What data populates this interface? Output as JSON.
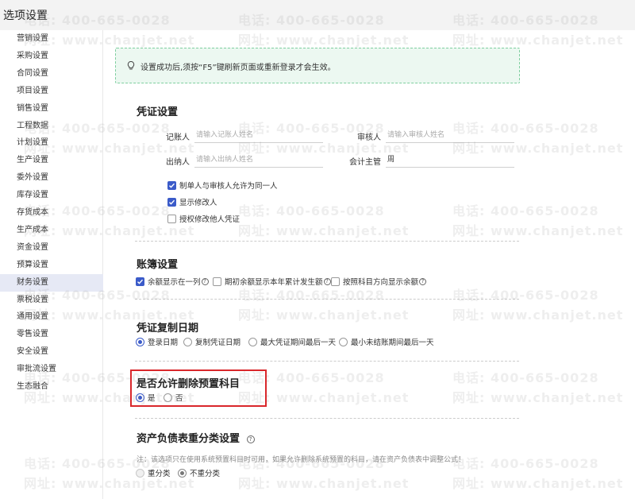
{
  "window": {
    "title": "选项设置"
  },
  "sidebar": {
    "items": [
      "营销设置",
      "采购设置",
      "合同设置",
      "项目设置",
      "销售设置",
      "工程数据",
      "计划设置",
      "生产设置",
      "委外设置",
      "库存设置",
      "存货成本",
      "生产成本",
      "资金设置",
      "预算设置",
      "财务设置",
      "票税设置",
      "通用设置",
      "零售设置",
      "安全设置",
      "审批流设置",
      "生态融合"
    ],
    "active_index": 14
  },
  "notice": {
    "text": "设置成功后,须按“F5”键刷新页面或重新登录才会生效。",
    "icon": "lightbulb-icon"
  },
  "voucher": {
    "title": "凭证设置",
    "bookkeeper_label": "记账人",
    "bookkeeper_placeholder": "请输入记账人姓名",
    "reviewer_label": "审核人",
    "reviewer_placeholder": "请输入审核人姓名",
    "cashier_label": "出纳人",
    "cashier_placeholder": "请输入出纳人姓名",
    "supervisor_label": "会计主管",
    "supervisor_value": "周",
    "checks": [
      {
        "label": "制单人与审核人允许为同一人",
        "checked": true
      },
      {
        "label": "显示修改人",
        "checked": true
      },
      {
        "label": "授权修改他人凭证",
        "checked": false
      }
    ]
  },
  "ledger": {
    "title": "账簿设置",
    "checks": [
      {
        "label": "余额显示在一列",
        "checked": true
      },
      {
        "label": "期初余额显示本年累计发生额",
        "checked": false
      },
      {
        "label": "按照科目方向显示余额",
        "checked": false
      }
    ],
    "help_glyph": "?"
  },
  "copy_date": {
    "title": "凭证复制日期",
    "options": [
      "登录日期",
      "复制凭证日期",
      "最大凭证期间最后一天",
      "最小未结账期间最后一天"
    ],
    "selected": 0
  },
  "delete_preset": {
    "title": "是否允许删除预置科目",
    "options": [
      "是",
      "否"
    ],
    "selected": 0
  },
  "balance_sheet": {
    "title": "资产负债表重分类设置",
    "help_glyph": "?",
    "note": "注：该选项只在使用系统预置科目时可用，如果允许删除系统预置的科目，请在资产负债表中调整公式！",
    "options": [
      "重分类",
      "不重分类"
    ],
    "selected": 1
  },
  "watermark": {
    "phone": "电话: 400-665-0028",
    "site": "网址: www.chanjet.net"
  },
  "colors": {
    "accent": "#3b5bc9",
    "highlight_border": "#d9272b",
    "notice_bg": "#ecf8f1"
  }
}
